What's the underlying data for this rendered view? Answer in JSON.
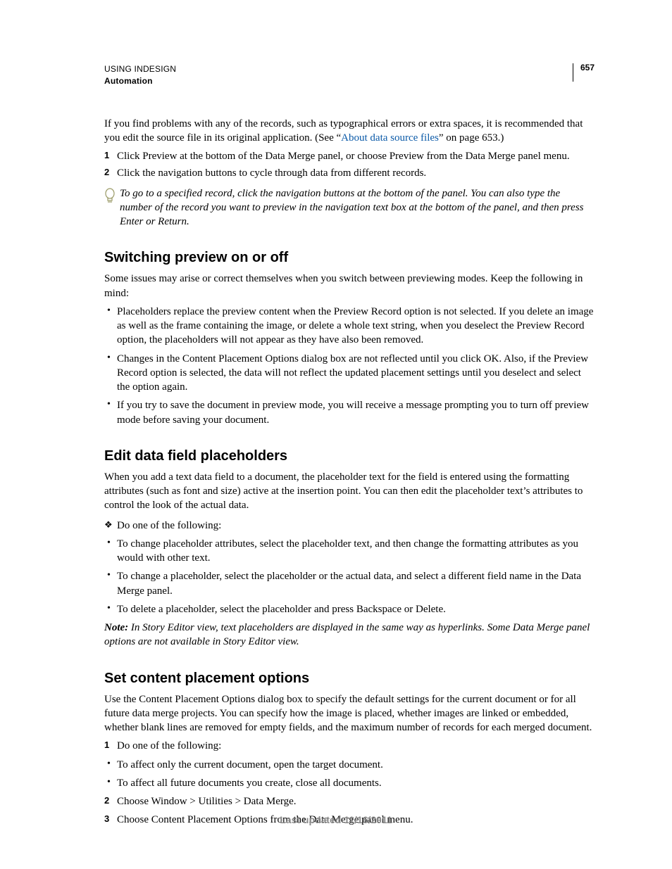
{
  "header": {
    "line1": "USING INDESIGN",
    "line2": "Automation",
    "page_number": "657"
  },
  "intro": {
    "text_before_link": "If you find problems with any of the records, such as typographical errors or extra spaces, it is recommended that you edit the source file in its original application. (See “",
    "link_text": "About data source files",
    "text_after_link": "” on page 653.)"
  },
  "steps_top": [
    "Click Preview at the bottom of the Data Merge panel, or choose Preview from the Data Merge panel menu.",
    "Click the navigation buttons to cycle through data from different records."
  ],
  "tip": "To go to a specified record, click the navigation buttons at the bottom of the panel. You can also type the number of the record you want to preview in the navigation text box at the bottom of the panel, and then press Enter or Return.",
  "section1": {
    "title": "Switching preview on or off",
    "intro": "Some issues may arise or correct themselves when you switch between previewing modes. Keep the following in mind:",
    "bullets": [
      "Placeholders replace the preview content when the Preview Record option is not selected. If you delete an image as well as the frame containing the image, or delete a whole text string, when you deselect the Preview Record option, the placeholders will not appear as they have also been removed.",
      "Changes in the Content Placement Options dialog box are not reflected until you click OK. Also, if the Preview Record option is selected, the data will not reflect the updated placement settings until you deselect and select the option again.",
      "If you try to save the document in preview mode, you will receive a message prompting you to turn off preview mode before saving your document."
    ]
  },
  "section2": {
    "title": "Edit data field placeholders",
    "intro": "When you add a text data field to a document, the placeholder text for the field is entered using the formatting attributes (such as font and size) active at the insertion point. You can then edit the placeholder text’s attributes to control the look of the actual data.",
    "diamond": "Do one of the following:",
    "bullets": [
      "To change placeholder attributes, select the placeholder text, and then change the formatting attributes as you would with other text.",
      "To change a placeholder, select the placeholder or the actual data, and select a different field name in the Data Merge panel.",
      "To delete a placeholder, select the placeholder and press Backspace or Delete."
    ],
    "note_label": "Note:",
    "note_body": " In Story Editor view, text placeholders are displayed in the same way as hyperlinks. Some Data Merge panel options are not available in Story Editor view."
  },
  "section3": {
    "title": "Set content placement options",
    "intro": "Use the Content Placement Options dialog box to specify the default settings for the current document or for all future data merge projects. You can specify how the image is placed, whether images are linked or embedded, whether blank lines are removed for empty fields, and the maximum number of records for each merged document.",
    "items": [
      "Do one of the following:",
      "To affect only the current document, open the target document.",
      "To affect all future documents you create, close all documents.",
      "Choose Window > Utilities > Data Merge.",
      "Choose Content Placement Options from the Data Merge panel menu."
    ]
  },
  "footer": "Last updated 11/16/2011"
}
